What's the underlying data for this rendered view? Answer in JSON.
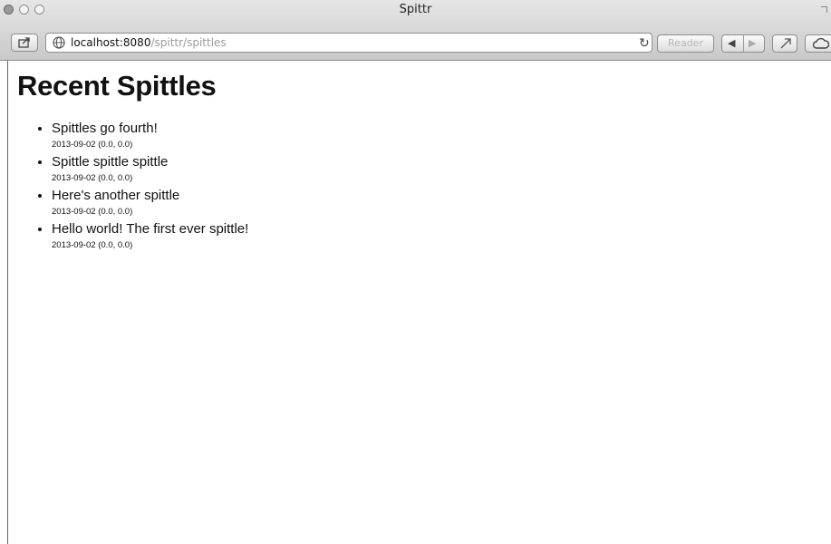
{
  "window": {
    "title": "Spittr"
  },
  "toolbar": {
    "url_host": "localhost:8080",
    "url_path": "/spittr/spittles",
    "reader_label": "Reader"
  },
  "page": {
    "heading": "Recent Spittles",
    "spittles": [
      {
        "message": "Spittles go fourth!",
        "meta": "2013-09-02 (0.0, 0.0)"
      },
      {
        "message": "Spittle spittle spittle",
        "meta": "2013-09-02 (0.0, 0.0)"
      },
      {
        "message": "Here's another spittle",
        "meta": "2013-09-02 (0.0, 0.0)"
      },
      {
        "message": "Hello world! The first ever spittle!",
        "meta": "2013-09-02 (0.0, 0.0)"
      }
    ]
  }
}
